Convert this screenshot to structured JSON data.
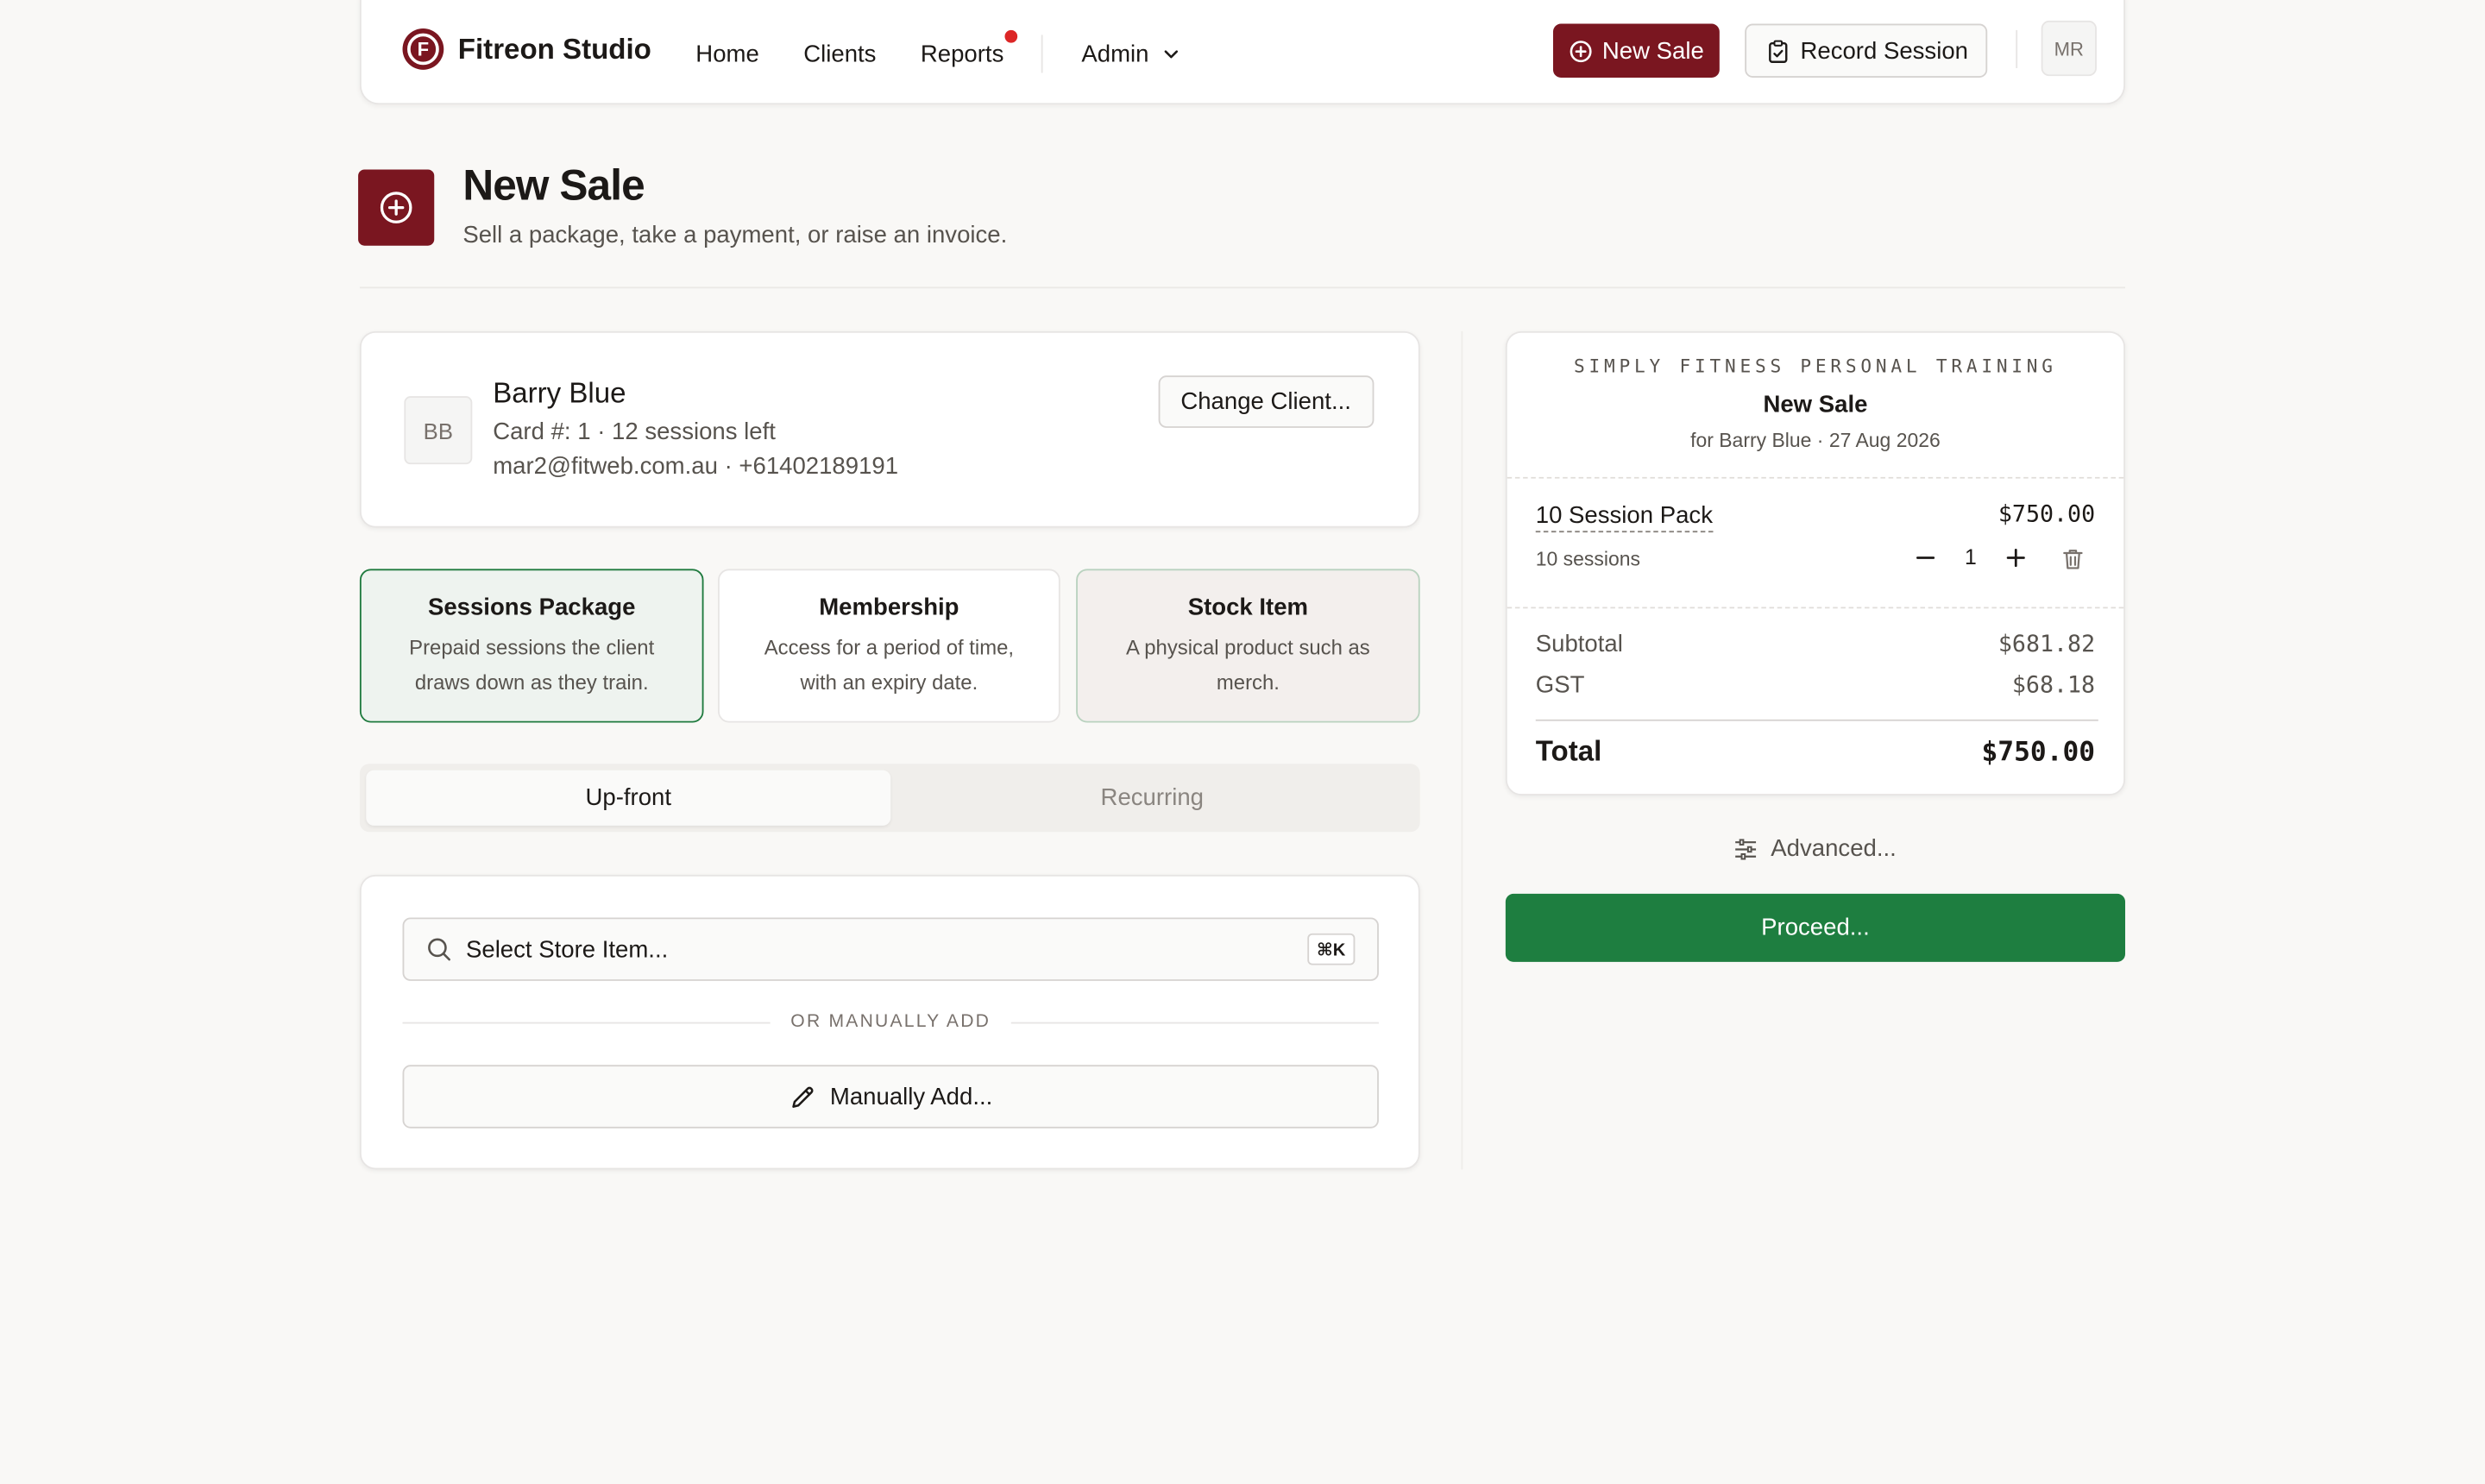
{
  "header": {
    "brand": "Fitreon Studio",
    "nav": [
      "Home",
      "Clients",
      "Reports",
      "Admin"
    ],
    "new_sale_label": "New Sale",
    "record_session_label": "Record Session",
    "user_initials": "MR"
  },
  "page": {
    "title": "New Sale",
    "subtitle": "Sell a package, take a payment, or raise an invoice."
  },
  "client": {
    "initials": "BB",
    "name": "Barry Blue",
    "card_line": "Card #: 1 · 12 sessions left",
    "contact_line": "mar2@fitweb.com.au · +61402189191",
    "change_label": "Change Client..."
  },
  "sale_types": [
    {
      "title": "Sessions Package",
      "desc": "Prepaid sessions the client draws down as they train.",
      "selected": true
    },
    {
      "title": "Membership",
      "desc": "Access for a period of time, with an expiry date.",
      "selected": false
    },
    {
      "title": "Stock Item",
      "desc": "A physical product such as merch.",
      "selected": false
    }
  ],
  "billing": {
    "options": [
      "Up-front",
      "Recurring"
    ],
    "selected": "Up-front"
  },
  "picker": {
    "search_label": "Select Store Item...",
    "shortcut": "⌘K",
    "divider": "OR MANUALLY ADD",
    "manual_label": "Manually Add..."
  },
  "receipt": {
    "company": "SIMPLY FITNESS PERSONAL TRAINING",
    "title": "New Sale",
    "subtitle": "for Barry Blue · 27 Aug 2026",
    "item": {
      "name": "10 Session Pack",
      "price": "$750.00",
      "meta": "10 sessions",
      "qty": "1"
    },
    "subtotal_label": "Subtotal",
    "subtotal": "$681.82",
    "gst_label": "GST",
    "gst": "$68.18",
    "total_label": "Total",
    "total": "$750.00"
  },
  "actions": {
    "advanced_label": "Advanced...",
    "proceed_label": "Proceed..."
  },
  "colors": {
    "brand": "#7a1620",
    "proceed": "#1e7e40",
    "notification": "#dc2626"
  }
}
